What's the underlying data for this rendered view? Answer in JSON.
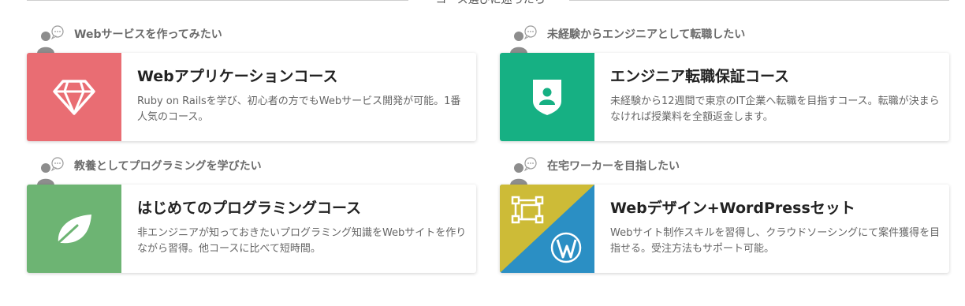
{
  "section_heading": "コース選びに迷ったら",
  "courses": [
    {
      "persona": "Webサービスを作ってみたい",
      "title": "Webアプリケーションコース",
      "description": "Ruby on Railsを学び、初心者の方でもWebサービス開発が可能。1番人気のコース。",
      "icon": "diamond-icon",
      "color": "#e96d73"
    },
    {
      "persona": "未経験からエンジニアとして転職したい",
      "title": "エンジニア転職保証コース",
      "description": "未経験から12週間で東京のIT企業へ転職を目指すコース。転職が決まらなければ授業料を全額返金します。",
      "icon": "shield-user-icon",
      "color": "#16b083"
    },
    {
      "persona": "教養としてプログラミングを学びたい",
      "title": "はじめてのプログラミングコース",
      "description": "非エンジニアが知っておきたいプログラミング知識をWebサイトを作りながら習得。他コースに比べて短時間。",
      "icon": "leaf-icon",
      "color": "#6db473"
    },
    {
      "persona": "在宅ワーカーを目指したい",
      "title": "Webデザイン+WordPressセット",
      "description": "Webサイト制作スキルを習得し、クラウドソーシングにて案件獲得を目指せる。受注方法もサポート可能。",
      "icon": "design-wordpress-icon",
      "colors": [
        "#cdbb37",
        "#2b8fc4"
      ]
    }
  ]
}
